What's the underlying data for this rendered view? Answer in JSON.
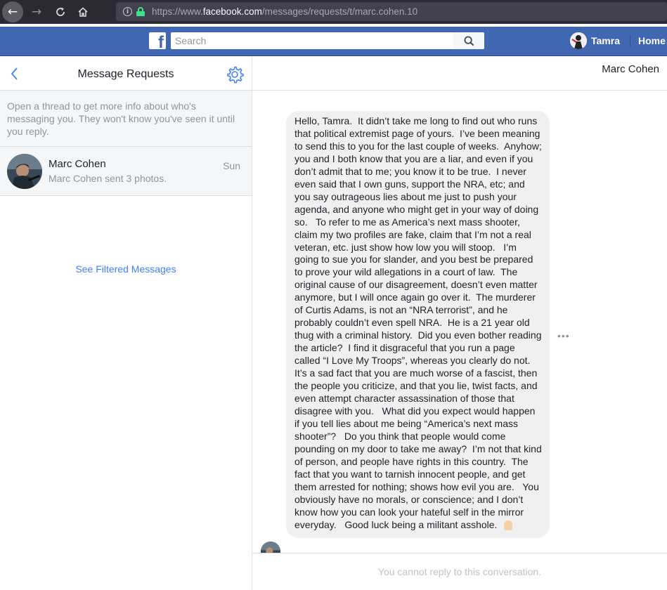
{
  "browser": {
    "url_prefix": "https://www.",
    "url_host": "facebook.com",
    "url_path": "/messages/requests/t/marc.cohen.10"
  },
  "fb_header": {
    "logo": "f",
    "search_placeholder": "Search",
    "user_name": "Tamra",
    "home_label": "Home"
  },
  "sidebar": {
    "title": "Message Requests",
    "info_text": "Open a thread to get more info about who's messaging you. They won't know you've seen it until you reply.",
    "threads": [
      {
        "name": "Marc Cohen",
        "preview": "Marc Cohen sent 3 photos.",
        "time": "Sun"
      }
    ],
    "see_filtered_label": "See Filtered Messages"
  },
  "conversation": {
    "contact_name": "Marc Cohen",
    "message": "Hello, Tamra.  It didn’t take me long to find out who runs that political extremist page of yours.  I’ve been meaning to send this to you for the last couple of weeks.  Anyhow; you and I both know that you are a liar, and even if you don’t admit that to me; you know it to be true.  I never even said that I own guns, support the NRA, etc; and you say outrageous lies about me just to push your agenda, and anyone who might get in your way of doing so.   To refer to me as America’s next mass shooter, claim my two profiles are fake, claim that I’m not a real veteran, etc. just show how low you will stoop.   I’m going to sue you for slander, and you best be prepared to prove your wild allegations in a court of law.  The original cause of our disagreement, doesn’t even matter anymore, but I will once again go over it.  The murderer of Curtis Adams, is not an “NRA terrorist”, and he probably couldn’t even spell NRA.  He is a 21 year old thug with a criminal history.  Did you even bother reading the article?  I find it disgraceful that you run a page called “I Love My Troops”, whereas you clearly do not.   It’s a sad fact that you are much worse of a fascist, then the people you criticize, and that you lie, twist facts, and even attempt character assassination of those that disagree with you.   What did you expect would happen if you tell lies about me being “America’s next mass shooter”?   Do you think that people would come pounding on my door to take me away?  I’m not that kind of person, and people have rights in this country.  The fact that you want to tarnish innocent people, and get them arrested for nothing; shows how evil you are.   You obviously have no morals, or conscience; and I don’t know how you can look your hateful self in the mirror everyday.   Good luck being a militant asshole.",
    "more_icon": "more-horizontal-icon",
    "reply_notice": "You cannot reply to this conversation."
  },
  "colors": {
    "fb_blue": "#4267b2",
    "link_blue": "#4080ff",
    "bubble_gray": "#f1f0f0",
    "muted_text": "#90949c"
  }
}
